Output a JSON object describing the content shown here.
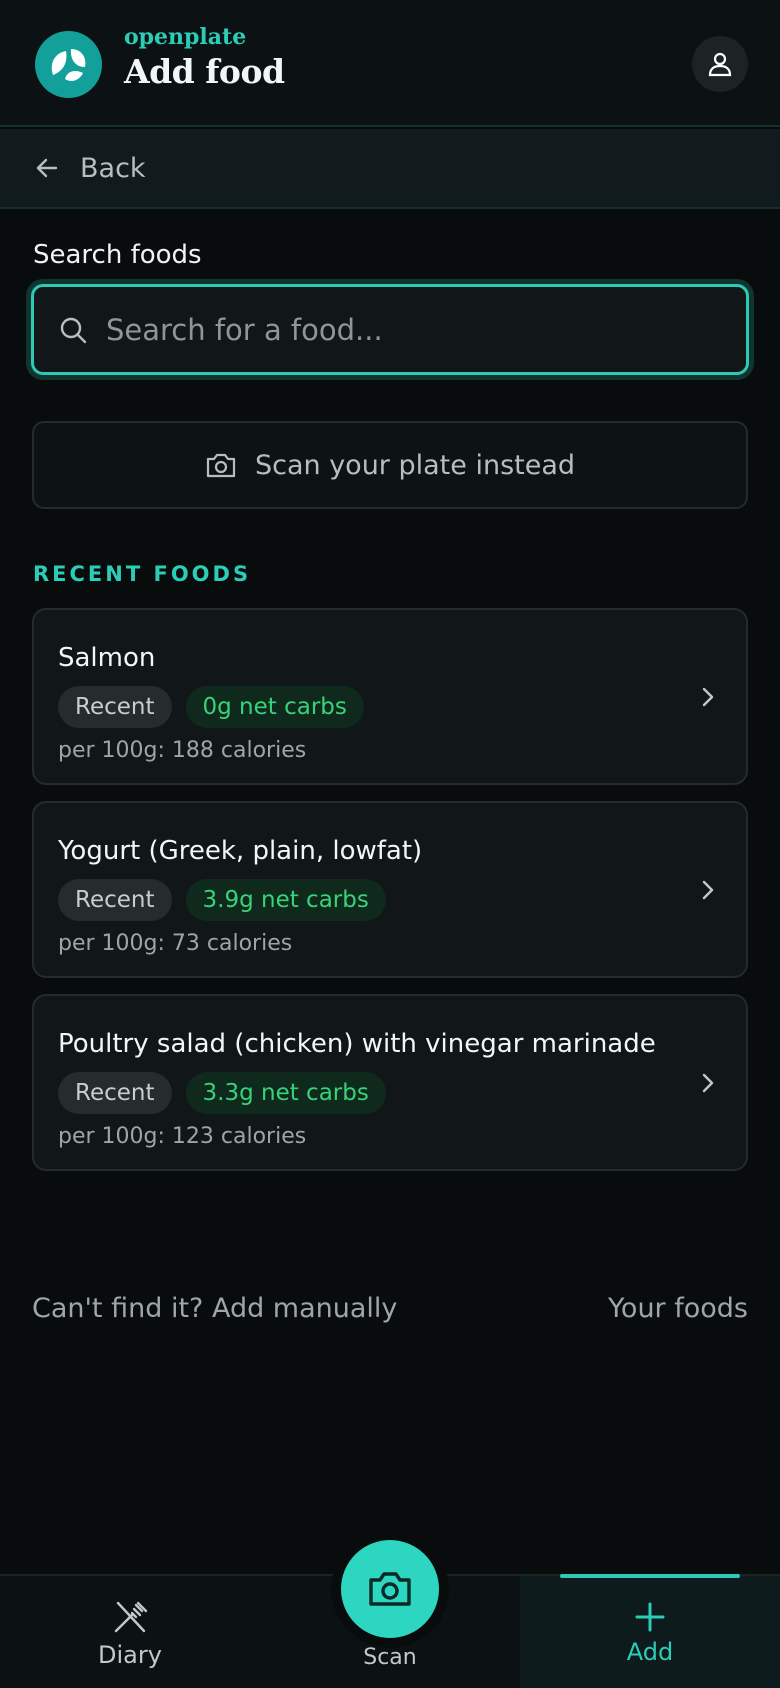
{
  "header": {
    "brand": "openplate",
    "title": "Add food",
    "logo_icon": "leaf-logo-icon",
    "profile_icon": "user-icon"
  },
  "back_bar": {
    "label": "Back",
    "icon": "arrow-left-icon"
  },
  "search": {
    "label": "Search foods",
    "placeholder": "Search for a food...",
    "value": ""
  },
  "scan_plate": {
    "label": "Scan your plate instead",
    "icon": "camera-icon"
  },
  "recent": {
    "section_title": "RECENT FOODS",
    "items": [
      {
        "name": "Salmon",
        "tag": "Recent",
        "carbs": "0g net carbs",
        "calories": "per 100g: 188 calories"
      },
      {
        "name": "Yogurt (Greek, plain, lowfat)",
        "tag": "Recent",
        "carbs": "3.9g net carbs",
        "calories": "per 100g: 73 calories"
      },
      {
        "name": "Poultry salad (chicken) with vinegar marinade",
        "tag": "Recent",
        "carbs": "3.3g net carbs",
        "calories": "per 100g: 123 calories"
      }
    ]
  },
  "links": {
    "manual": "Can't find it? Add manually",
    "your_foods": "Your foods"
  },
  "nav": {
    "diary": "Diary",
    "scan": "Scan",
    "add": "Add",
    "active": "add"
  },
  "colors": {
    "accent": "#2ccdb6",
    "carbs_green": "#38d27a",
    "background": "#080c0d"
  }
}
